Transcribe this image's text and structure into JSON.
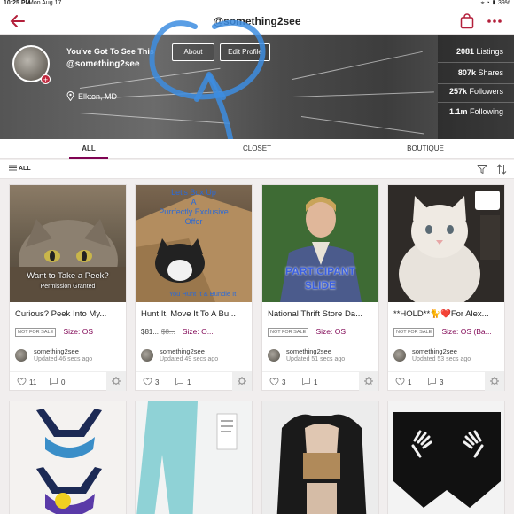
{
  "status": {
    "time": "10:25 PM",
    "date": "Mon Aug 17",
    "battery": "39%"
  },
  "header": {
    "handle": "@something2see"
  },
  "profile": {
    "shop_name": "You've Got To See This",
    "handle": "@something2see",
    "about_label": "About",
    "edit_label": "Edit Profile",
    "location": "Elkton, MD"
  },
  "stats": [
    {
      "value": "2081",
      "label": "Listings"
    },
    {
      "value": "807k",
      "label": "Shares"
    },
    {
      "value": "257k",
      "label": "Followers"
    },
    {
      "value": "1.1m",
      "label": "Following"
    }
  ],
  "tabs": [
    "ALL",
    "CLOSET",
    "BOUTIQUE"
  ],
  "filter": {
    "label": "ALL"
  },
  "listings": [
    {
      "title": "Curious?  Peek Into My...",
      "badge": "NOT FOR SALE",
      "price": "",
      "price_old": "",
      "size": "Size: OS",
      "seller": "something2see",
      "updated": "Updated 46 secs ago",
      "likes": "11",
      "comments": "0",
      "photo_text": [
        "Want to Take a Peek?",
        "Permission Granted"
      ]
    },
    {
      "title": "Hunt It, Move It To A Bu...",
      "badge": "",
      "price": "$81...",
      "price_old": "$8...",
      "size": "Size: O...",
      "seller": "something2see",
      "updated": "Updated 49 secs ago",
      "likes": "3",
      "comments": "1",
      "photo_text": [
        "Let's Box Up",
        "A",
        "Purrfectly Exclusive",
        "Offer",
        "You Hunt It & Bundle It"
      ]
    },
    {
      "title": "National Thrift Store Da...",
      "badge": "NOT FOR SALE",
      "price": "",
      "price_old": "",
      "size": "Size: OS",
      "seller": "something2see",
      "updated": "Updated 51 secs ago",
      "likes": "3",
      "comments": "1",
      "photo_text": [
        "PARTICIPANT",
        "SLIDE"
      ]
    },
    {
      "title": "**HOLD**🐈❤️For Alex...",
      "badge": "NOT FOR SALE",
      "price": "",
      "price_old": "",
      "size": "Size: OS (Ba...",
      "seller": "something2see",
      "updated": "Updated 53 secs ago",
      "likes": "1",
      "comments": "3",
      "photo_text": []
    }
  ],
  "colors": {
    "accent": "#7f0353",
    "brand_red": "#c0283d",
    "scribble": "#3d8de0"
  }
}
